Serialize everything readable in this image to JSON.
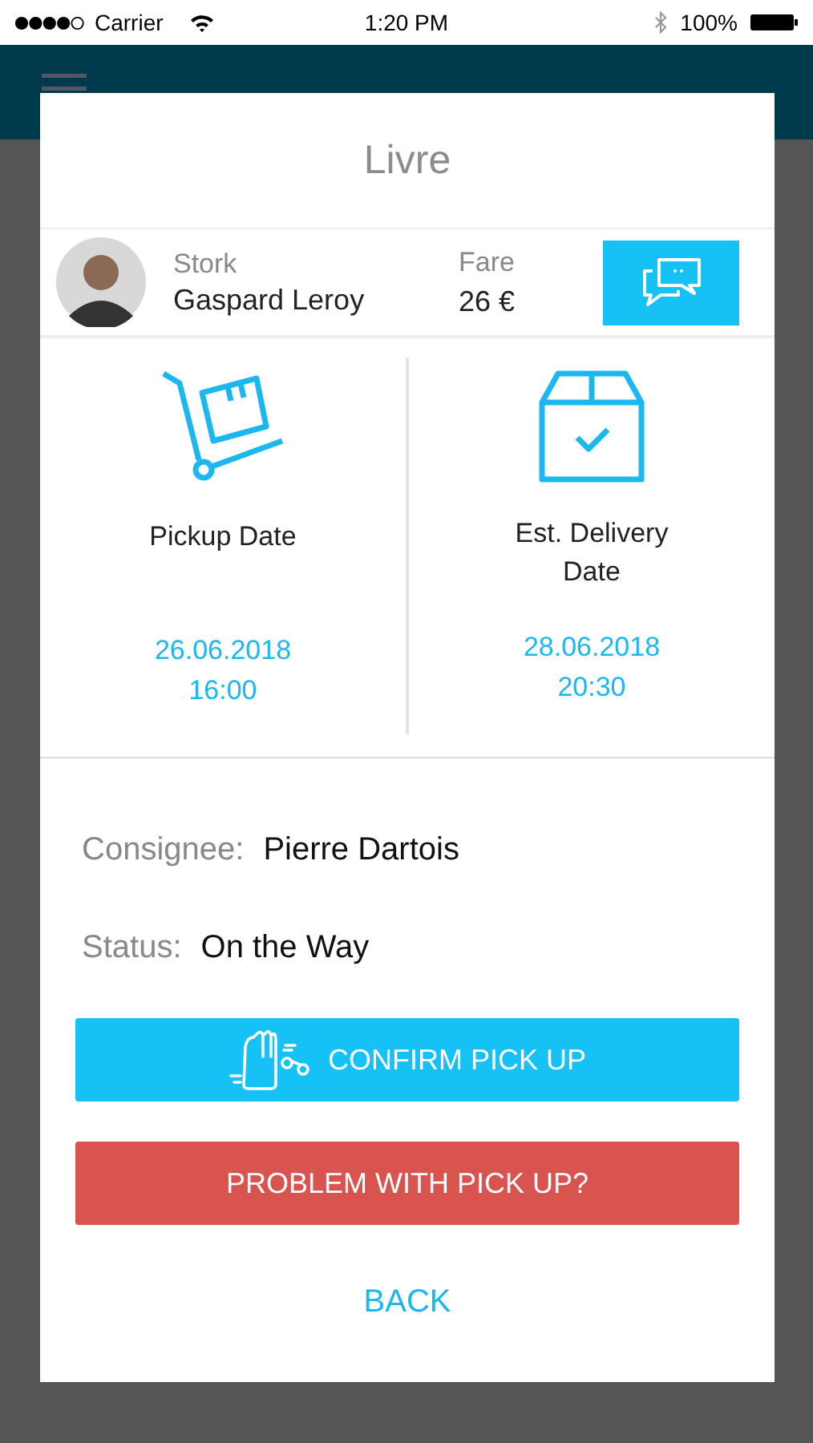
{
  "status_bar": {
    "carrier": "Carrier",
    "time": "1:20 PM",
    "battery": "100%"
  },
  "dialog": {
    "title": "Livre",
    "stork": {
      "label": "Stork",
      "name": "Gaspard Leroy"
    },
    "fare": {
      "label": "Fare",
      "value": "26 €"
    },
    "dates": [
      {
        "kind": "pickup",
        "label": "Pickup Date",
        "date": "26.06.2018",
        "time": "16:00"
      },
      {
        "kind": "delivery",
        "label": "Est. Delivery Date",
        "date": "28.06.2018",
        "time": "20:30"
      }
    ],
    "details": [
      {
        "label": "Consignee:",
        "value": "Pierre Dartois"
      },
      {
        "label": "Status:",
        "value": "On the Way"
      }
    ],
    "buttons": [
      {
        "kind": "confirm",
        "label": "CONFIRM PICK UP"
      },
      {
        "kind": "problem",
        "label": "PROBLEM WITH PICK UP?"
      },
      {
        "kind": "link",
        "label": "BACK"
      }
    ]
  }
}
